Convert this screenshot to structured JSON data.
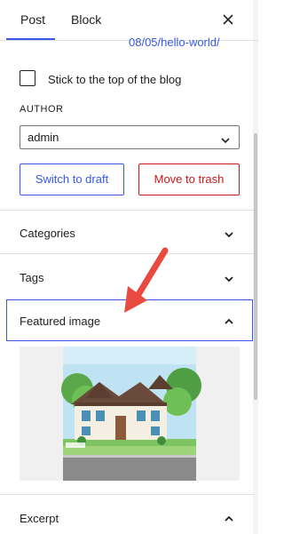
{
  "tabs": [
    {
      "label": "Post"
    },
    {
      "label": "Block"
    }
  ],
  "post_url": {
    "partial": "08/05/hello-world/"
  },
  "sticky": {
    "label": "Stick to the top of the blog"
  },
  "author": {
    "label": "AUTHOR",
    "selected": "admin"
  },
  "actions": {
    "switch_to_draft": "Switch to draft",
    "move_to_trash": "Move to trash"
  },
  "panels": {
    "categories": "Categories",
    "tags": "Tags",
    "featured_image": "Featured image",
    "excerpt": "Excerpt"
  },
  "colors": {
    "accent": "#3858e9",
    "danger": "#cc1818",
    "arrow": "#e94a3f"
  }
}
